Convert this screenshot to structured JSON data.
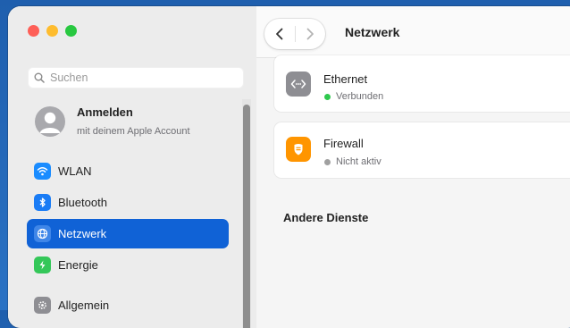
{
  "colors": {
    "accent": "#1062d6",
    "connected": "#2fc94e",
    "inactive": "#a0a0a0",
    "wlan_icon": "#1a8cff",
    "bluetooth_icon": "#1a7cf5",
    "energie_icon": "#34c759",
    "firewall_icon": "#ff9500",
    "ethernet_icon": "#8e8e93"
  },
  "sidebar": {
    "search": {
      "placeholder": "Suchen"
    },
    "account": {
      "title": "Anmelden",
      "subtitle": "mit deinem Apple Account"
    },
    "items": [
      {
        "label": "WLAN",
        "icon": "wifi-icon",
        "active": false
      },
      {
        "label": "Bluetooth",
        "icon": "bluetooth-icon",
        "active": false
      },
      {
        "label": "Netzwerk",
        "icon": "globe-icon",
        "active": true
      },
      {
        "label": "Energie",
        "icon": "battery-icon",
        "active": false
      },
      {
        "label": "Allgemein",
        "icon": "gear-icon",
        "active": false
      }
    ]
  },
  "main": {
    "title": "Netzwerk",
    "services": [
      {
        "name": "Ethernet",
        "status": "Verbunden",
        "icon": "ethernet-icon"
      },
      {
        "name": "Firewall",
        "status": "Nicht aktiv",
        "icon": "firewall-icon"
      }
    ],
    "section_title": "Andere Dienste"
  }
}
